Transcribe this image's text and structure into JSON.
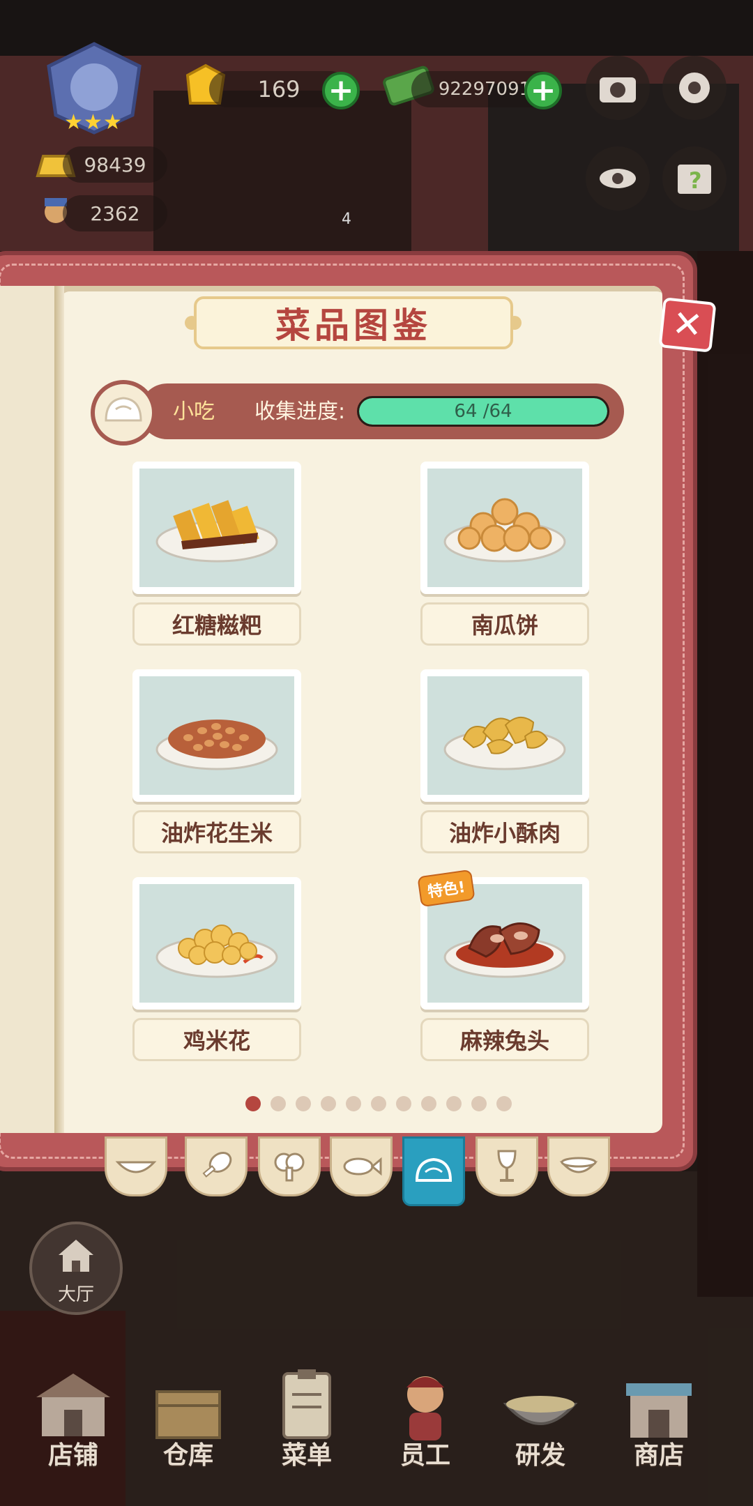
{
  "hud": {
    "gems": "169",
    "cash": "92297091",
    "gold": "98439",
    "staff_count": "2362",
    "dish_count": "4"
  },
  "modal": {
    "title": "菜品图鉴",
    "category": "小吃",
    "progress_label": "收集进度:",
    "progress_current": 64,
    "progress_total": 64,
    "progress_text": "64 /64",
    "dishes": [
      {
        "name": "红糖糍粑",
        "badge": ""
      },
      {
        "name": "南瓜饼",
        "badge": ""
      },
      {
        "name": "油炸花生米",
        "badge": ""
      },
      {
        "name": "油炸小酥肉",
        "badge": ""
      },
      {
        "name": "鸡米花",
        "badge": ""
      },
      {
        "name": "麻辣兔头",
        "badge": "特色!"
      }
    ],
    "page_count": 11,
    "current_page": 1,
    "tabs": [
      "wok-icon",
      "drumstick-icon",
      "broccoli-icon",
      "fish-icon",
      "bun-icon",
      "wine-glass-icon",
      "soup-bowl-icon"
    ],
    "active_tab": 4
  },
  "hall_label": "大厅",
  "nav": [
    "店铺",
    "仓库",
    "菜单",
    "员工",
    "研发",
    "商店"
  ],
  "colors": {
    "accent": "#b5463f",
    "book": "#b9585a",
    "progress": "#5ee0aa",
    "active_tab": "#2a9fbf"
  }
}
